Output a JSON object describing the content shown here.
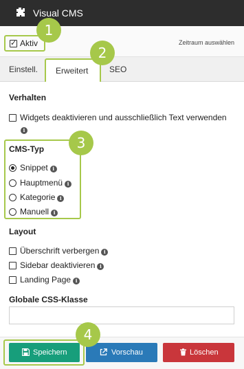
{
  "app": {
    "title": "Visual CMS",
    "logo_icon": "puzzle-icon"
  },
  "topbar": {
    "active_label": "Aktiv",
    "active_checked": true,
    "period_link": "Zeitraum auswählen"
  },
  "tabs": [
    {
      "label": "Einstell.",
      "active": false
    },
    {
      "label": "Erweitert",
      "active": true
    },
    {
      "label": "SEO",
      "active": false
    }
  ],
  "behavior": {
    "heading": "Verhalten",
    "widgets_only_text": {
      "label": "Widgets deaktivieren und ausschließlich Text verwenden",
      "checked": false
    }
  },
  "cms_type": {
    "heading": "CMS-Typ",
    "options": [
      {
        "label": "Snippet",
        "selected": true
      },
      {
        "label": "Hauptmenü",
        "selected": false
      },
      {
        "label": "Kategorie",
        "selected": false
      },
      {
        "label": "Manuell",
        "selected": false
      }
    ]
  },
  "layout": {
    "heading": "Layout",
    "options": [
      {
        "label": "Überschrift verbergen",
        "checked": false
      },
      {
        "label": "Sidebar deaktivieren",
        "checked": false
      },
      {
        "label": "Landing Page",
        "checked": false
      }
    ]
  },
  "css_class": {
    "heading": "Globale CSS-Klasse",
    "value": ""
  },
  "footer": {
    "save_label": "Speichern",
    "preview_label": "Vorschau",
    "delete_label": "Löschen"
  },
  "callouts": [
    "1",
    "2",
    "3",
    "4"
  ],
  "colors": {
    "accent_green": "#a6c84a",
    "save": "#179e7b",
    "preview": "#2a7ab8",
    "delete": "#c9363b",
    "titlebar": "#2d2d2d"
  }
}
